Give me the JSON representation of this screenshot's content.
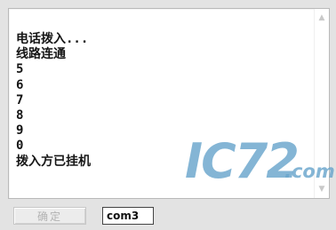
{
  "log": {
    "lines": [
      "电话拨入...",
      "线路连通",
      "5",
      "6",
      "7",
      "8",
      "9",
      "0",
      "拨入方已挂机"
    ]
  },
  "scrollbar": {
    "up_icon": "triangle-up-icon",
    "down_icon": "triangle-down-icon"
  },
  "watermark": {
    "main_text": "IC72",
    "suffix_text": ".com",
    "color": "#6aa6cc"
  },
  "controls": {
    "ok_label": "确定",
    "port_value": "com3"
  }
}
